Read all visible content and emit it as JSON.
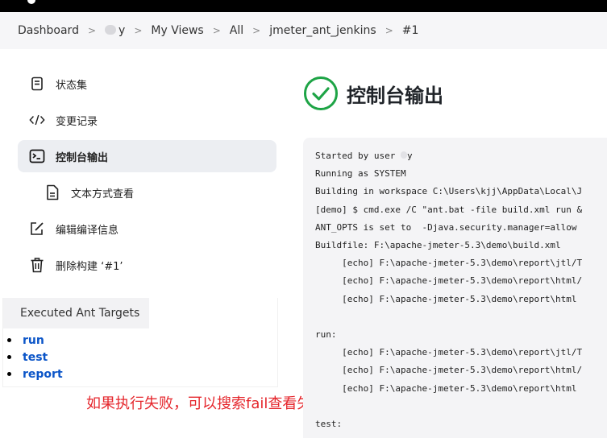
{
  "breadcrumb": {
    "items": [
      "Dashboard",
      "y",
      "My Views",
      "All",
      "jmeter_ant_jenkins",
      "#1"
    ]
  },
  "sidebar": {
    "items": [
      {
        "label": "状态集",
        "icon": "document-icon"
      },
      {
        "label": "变更记录",
        "icon": "code-icon"
      },
      {
        "label": "控制台输出",
        "icon": "terminal-icon"
      },
      {
        "label": "文本方式查看",
        "icon": "text-file-icon"
      },
      {
        "label": "编辑编译信息",
        "icon": "edit-icon"
      },
      {
        "label": "删除构建 ‘#1’",
        "icon": "trash-icon"
      }
    ],
    "active_index": 2
  },
  "ant_targets": {
    "title": "Executed Ant Targets",
    "items": [
      "run",
      "test",
      "report"
    ]
  },
  "annotation": "如果执行失败，可以搜索fail查看失败的原因",
  "page": {
    "title": "控制台输出",
    "status_icon": "success-check-icon"
  },
  "console": {
    "lines": [
      "Started by user ",
      "Running as SYSTEM",
      "Building in workspace C:\\Users\\kjj\\AppData\\Local\\J",
      "[demo] $ cmd.exe /C \"ant.bat -file build.xml run &",
      "ANT_OPTS is set to  -Djava.security.manager=allow",
      "Buildfile: F:\\apache-jmeter-5.3\\demo\\build.xml",
      "     [echo] F:\\apache-jmeter-5.3\\demo\\report\\jtl/T",
      "     [echo] F:\\apache-jmeter-5.3\\demo\\report\\html/",
      "     [echo] F:\\apache-jmeter-5.3\\demo\\report\\html",
      "",
      "run:",
      "     [echo] F:\\apache-jmeter-5.3\\demo\\report\\jtl/T",
      "     [echo] F:\\apache-jmeter-5.3\\demo\\report\\html/",
      "     [echo] F:\\apache-jmeter-5.3\\demo\\report\\html",
      "",
      "test:"
    ],
    "user_suffix": "y"
  },
  "colors": {
    "success": "#1ea446",
    "link": "#0b55c8",
    "annotation": "#e5262c"
  }
}
